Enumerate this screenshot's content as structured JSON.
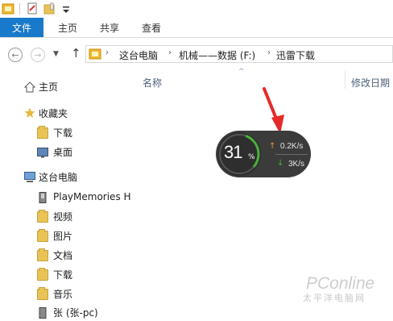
{
  "ribbon": {
    "file_label": "文件",
    "tabs": [
      "主页",
      "共享",
      "查看"
    ]
  },
  "address": {
    "crumbs": [
      "这台电脑",
      "机械——数据 (F:)",
      "迅雷下载"
    ]
  },
  "sidebar": {
    "items": [
      {
        "label": "主页",
        "icon": "home-icon"
      },
      {
        "label": "收藏夹",
        "icon": "star-icon"
      },
      {
        "label": "下载",
        "icon": "download-folder-icon"
      },
      {
        "label": "桌面",
        "icon": "desktop-icon"
      },
      {
        "label": "这台电脑",
        "icon": "computer-icon"
      },
      {
        "label": "PlayMemories H",
        "icon": "device-icon"
      },
      {
        "label": "视频",
        "icon": "video-folder-icon"
      },
      {
        "label": "图片",
        "icon": "pictures-folder-icon"
      },
      {
        "label": "文档",
        "icon": "documents-folder-icon"
      },
      {
        "label": "下载",
        "icon": "download-folder-icon"
      },
      {
        "label": "音乐",
        "icon": "music-folder-icon"
      },
      {
        "label": "张 (张-pc)",
        "icon": "network-computer-icon"
      }
    ]
  },
  "main": {
    "columns": [
      "名称",
      "修改日期"
    ]
  },
  "widget": {
    "percent": "31",
    "percent_sign": "%",
    "upload_speed": "0.2K/s",
    "download_speed": "3K/s",
    "progress": 0.31
  },
  "watermark": {
    "text": "PConline",
    "sub": "太平洋电脑网"
  },
  "colors": {
    "accent": "#1979ca",
    "annotation_arrow": "#e52a2a",
    "progress": "#4caf3c"
  }
}
